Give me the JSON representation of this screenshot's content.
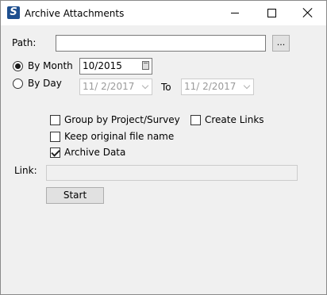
{
  "window": {
    "title": "Archive Attachments",
    "app_icon_letter": "S",
    "icons": {
      "app": "app-logo-icon",
      "minimize": "minimize-icon",
      "maximize": "maximize-icon",
      "close": "close-icon"
    }
  },
  "path": {
    "label": "Path:",
    "value": "",
    "browse_label": "..."
  },
  "by_month": {
    "label": "By Month",
    "selected": true,
    "value": "10/2015",
    "icon": "calendar-icon"
  },
  "by_day": {
    "label": "By Day",
    "selected": false,
    "from": "11/ 2/2017",
    "to_label": "To",
    "to": "11/ 2/2017",
    "icon": "chevron-down-icon"
  },
  "options": {
    "group_by_project": {
      "label": "Group by Project/Survey",
      "checked": false
    },
    "create_links": {
      "label": "Create Links",
      "checked": false
    },
    "keep_original": {
      "label": "Keep original file name",
      "checked": false
    },
    "archive_data": {
      "label": "Archive Data",
      "checked": true
    }
  },
  "link": {
    "label": "Link:",
    "value": ""
  },
  "start_label": "Start"
}
